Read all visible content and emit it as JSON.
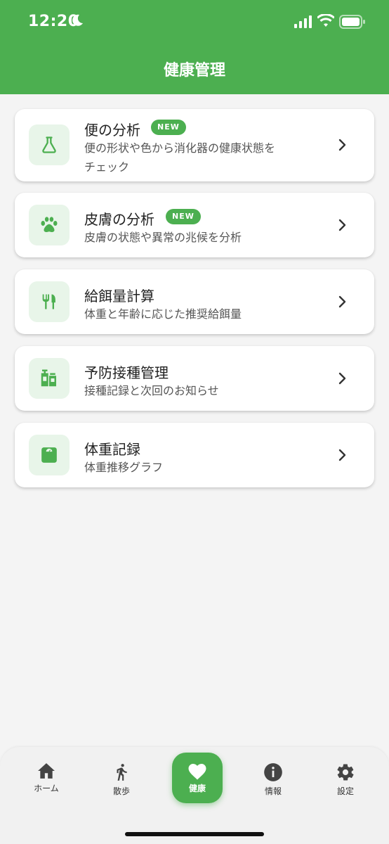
{
  "status_bar": {
    "time": "12:20"
  },
  "header": {
    "title": "健康管理"
  },
  "cards": [
    {
      "title": "便の分析",
      "badge": "NEW",
      "desc_line1": "便の形状や色から消化器の健康状態を",
      "desc_line2": "チェック",
      "icon": "flask-icon"
    },
    {
      "title": "皮膚の分析",
      "badge": "NEW",
      "description": "皮膚の状態や異常の兆候を分析",
      "icon": "paw-icon"
    },
    {
      "title": "給餌量計算",
      "description": "体重と年齢に応じた推奨給餌量",
      "icon": "fork-knife-icon"
    },
    {
      "title": "予防接種管理",
      "description": "接種記録と次回のお知らせ",
      "icon": "vaccine-icon"
    },
    {
      "title": "体重記録",
      "description": "体重推移グラフ",
      "icon": "scale-icon"
    }
  ],
  "nav": {
    "items": [
      {
        "label": "ホーム",
        "icon": "home-icon"
      },
      {
        "label": "散歩",
        "icon": "walk-icon"
      },
      {
        "label": "健康",
        "icon": "heart-icon",
        "active": true
      },
      {
        "label": "情報",
        "icon": "info-icon"
      },
      {
        "label": "設定",
        "icon": "gear-icon"
      }
    ]
  },
  "colors": {
    "primary": "#4caf50",
    "icon_bg": "#e8f5e9",
    "background": "#f4f4f4"
  }
}
